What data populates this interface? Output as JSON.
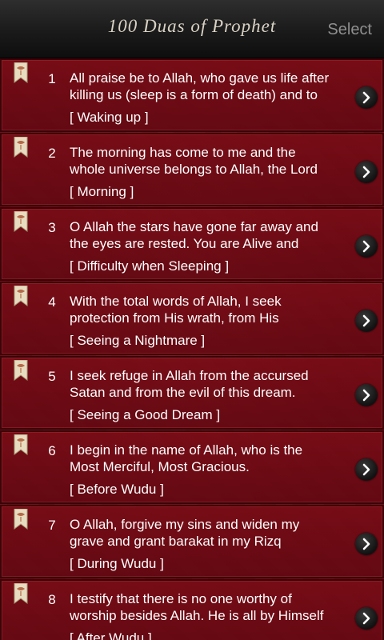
{
  "header": {
    "title": "100 Duas of Prophet",
    "select_label": "Select"
  },
  "icons": {
    "bookmark": "bookmark-icon",
    "chevron": "chevron-right-icon"
  },
  "colors": {
    "row_background": "#7a0c16",
    "row_border": "#3a0408",
    "header_background": "#1a1a1a",
    "bookmark": "#e8dcc0"
  },
  "duas": [
    {
      "number": "1",
      "line1": "All praise be to Allah, who gave us life after",
      "line2": "killing us (sleep is a form of death) and to",
      "topic": "[ Waking up ]"
    },
    {
      "number": "2",
      "line1": "The morning has come to me and the",
      "line2": "whole universe belongs to Allah, the Lord",
      "topic": "[ Morning ]"
    },
    {
      "number": "3",
      "line1": "O Allah the stars have gone far away and",
      "line2": "the eyes are rested. You are Alive and",
      "topic": "[ Difficulty when Sleeping ]"
    },
    {
      "number": "4",
      "line1": "With the total words of Allah, I seek",
      "line2": "protection from His wrath, from His",
      "topic": "[ Seeing a Nightmare ]"
    },
    {
      "number": "5",
      "line1": "I seek refuge in Allah from the accursed",
      "line2": "Satan and from the evil of this dream.",
      "topic": "[ Seeing a Good Dream ]"
    },
    {
      "number": "6",
      "line1": "I begin in the name of Allah, who is the",
      "line2": "Most Merciful, Most Gracious.",
      "topic": "[ Before Wudu ]"
    },
    {
      "number": "7",
      "line1": "O Allah, forgive my sins and widen my",
      "line2": "grave and grant barakat in my Rizq",
      "topic": "[ During Wudu ]"
    },
    {
      "number": "8",
      "line1": "I testify that there is no one worthy of",
      "line2": "worship besides Allah. He is all by Himself",
      "topic": "[ After Wudu ]"
    }
  ]
}
